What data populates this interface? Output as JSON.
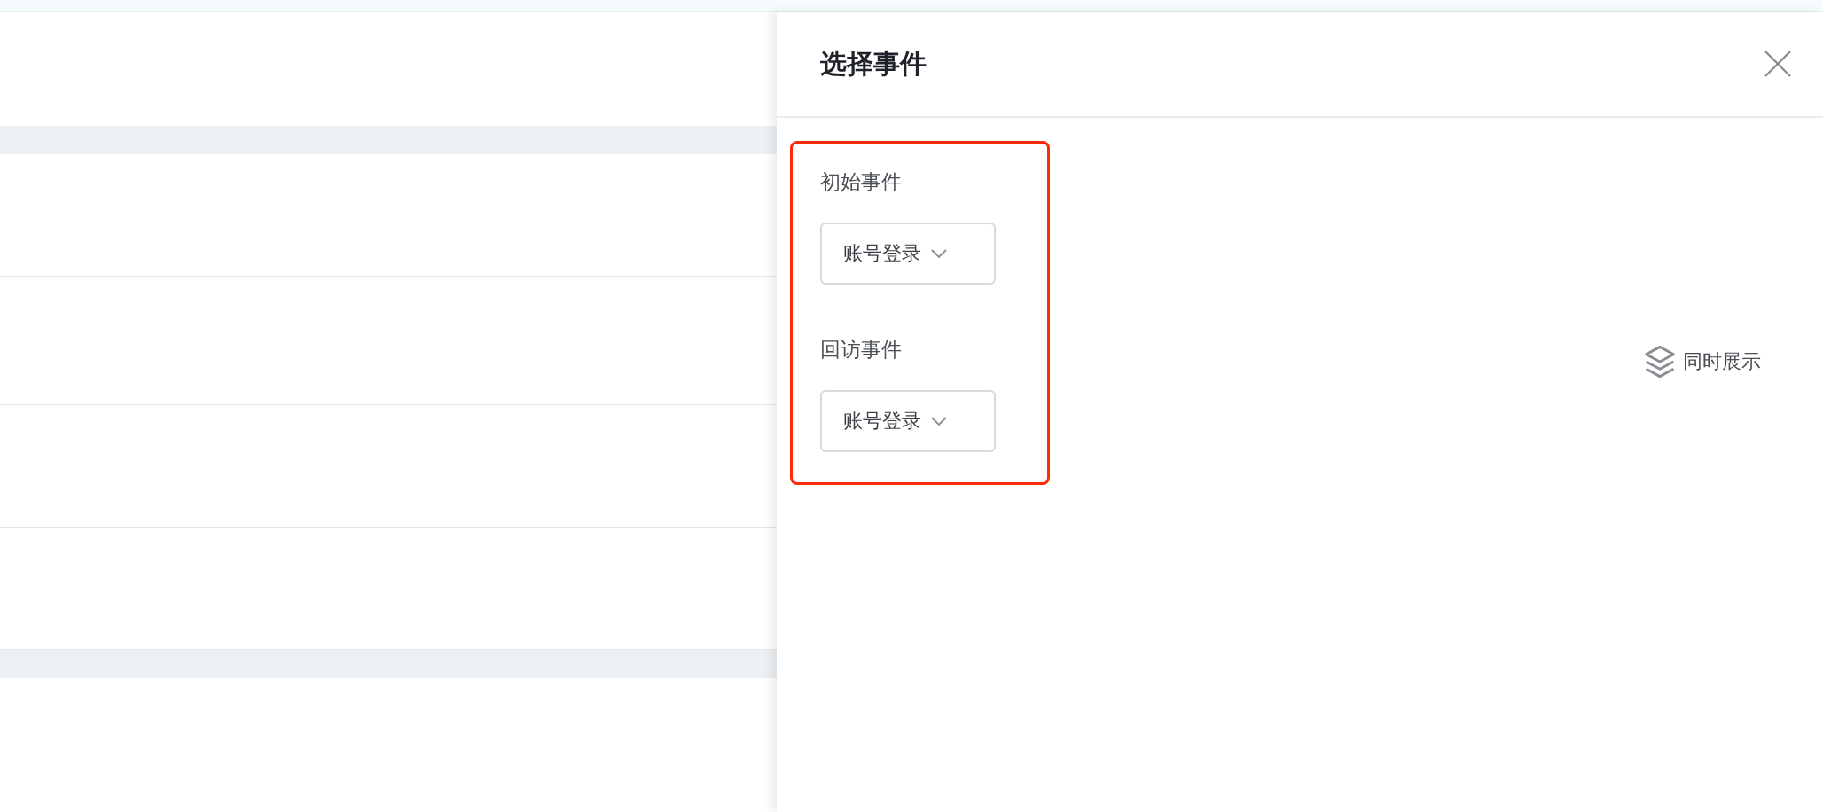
{
  "drawer": {
    "title": "选择事件",
    "fields": [
      {
        "label": "初始事件",
        "value": "账号登录"
      },
      {
        "label": "回访事件",
        "value": "账号登录"
      }
    ],
    "show_together": {
      "label": "同时展示"
    }
  }
}
